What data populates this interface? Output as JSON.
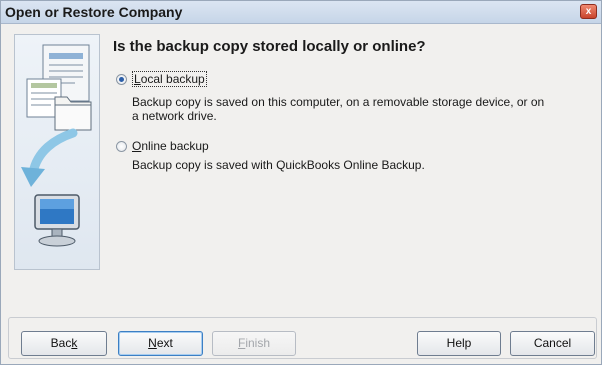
{
  "window": {
    "title": "Open or Restore Company",
    "close_glyph": "x"
  },
  "question": "Is the backup copy stored locally or online?",
  "options": [
    {
      "label_prefix": "",
      "label_accel": "L",
      "label_rest": "ocal backup",
      "description_line1": "Backup copy is saved on this computer, on a removable storage device, or on",
      "description_line2": "a network drive.",
      "selected": true
    },
    {
      "label_prefix": "",
      "label_accel": "O",
      "label_rest": "nline backup",
      "description_line1": "Backup copy is saved with QuickBooks Online Backup.",
      "selected": false
    }
  ],
  "buttons": {
    "back": {
      "prefix": "Bac",
      "accel": "k",
      "rest": ""
    },
    "next": {
      "prefix": "",
      "accel": "N",
      "rest": "ext"
    },
    "finish": {
      "prefix": "",
      "accel": "F",
      "rest": "inish",
      "disabled": true
    },
    "help": {
      "label": "Help"
    },
    "cancel": {
      "label": "Cancel"
    }
  },
  "colors": {
    "accent": "#2b5ea8",
    "close_button": "#c8442c"
  },
  "icons": {
    "illustration": "backup-illustration",
    "documents": "documents-icon",
    "folder": "folder-icon",
    "arrow": "curved-arrow-icon",
    "monitor": "computer-monitor-icon"
  }
}
